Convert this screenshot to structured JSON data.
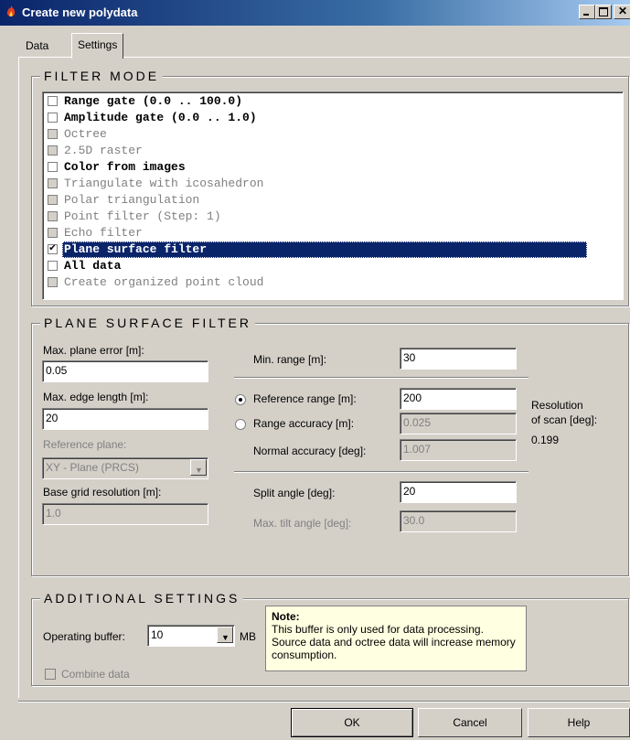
{
  "window": {
    "title": "Create new polydata"
  },
  "tabs": [
    {
      "label": "Data"
    },
    {
      "label": "Settings"
    }
  ],
  "filter_mode": {
    "title": "FILTER MODE",
    "items": [
      {
        "label": "Range gate (0.0 .. 100.0)",
        "checked": false,
        "enabled": true
      },
      {
        "label": "Amplitude gate (0.0 .. 1.0)",
        "checked": false,
        "enabled": true
      },
      {
        "label": "Octree",
        "checked": false,
        "enabled": false
      },
      {
        "label": "2.5D raster",
        "checked": false,
        "enabled": false
      },
      {
        "label": "Color from images",
        "checked": false,
        "enabled": true
      },
      {
        "label": "Triangulate with icosahedron",
        "checked": false,
        "enabled": false
      },
      {
        "label": "Polar triangulation",
        "checked": false,
        "enabled": false
      },
      {
        "label": "Point filter (Step: 1)",
        "checked": false,
        "enabled": false
      },
      {
        "label": "Echo filter",
        "checked": false,
        "enabled": false
      },
      {
        "label": "Plane surface filter",
        "checked": true,
        "enabled": true,
        "selected": true
      },
      {
        "label": "All data",
        "checked": false,
        "enabled": true
      },
      {
        "label": "Create organized point cloud",
        "checked": false,
        "enabled": false
      }
    ]
  },
  "plane_surface": {
    "title": "PLANE SURFACE FILTER",
    "max_plane_error_label": "Max. plane error [m]:",
    "max_plane_error": "0.05",
    "max_edge_length_label": "Max. edge length [m]:",
    "max_edge_length": "20",
    "reference_plane_label": "Reference plane:",
    "reference_plane": "XY - Plane (PRCS)",
    "base_grid_label": "Base grid resolution [m]:",
    "base_grid": "1.0",
    "min_range_label": "Min. range [m]:",
    "min_range": "30",
    "reference_range_label": "Reference range [m]:",
    "reference_range": "200",
    "range_accuracy_label": "Range accuracy [m]:",
    "range_accuracy": "0.025",
    "normal_accuracy_label": "Normal accuracy [deg]:",
    "normal_accuracy": "1.007",
    "split_angle_label": "Split angle [deg]:",
    "split_angle": "20",
    "max_tilt_label": "Max. tilt angle [deg]:",
    "max_tilt": "30.0",
    "resolution_label_1": "Resolution",
    "resolution_label_2": "of scan [deg]:",
    "resolution_value": "0.199"
  },
  "additional": {
    "title": "ADDITIONAL SETTINGS",
    "operating_buffer_label": "Operating buffer:",
    "operating_buffer": "10",
    "unit": "MB",
    "combine_label": "Combine data",
    "note_title": "Note:",
    "note_text": "This buffer is only used for data processing. Source data and octree data will increase memory consumption."
  },
  "buttons": {
    "ok": "OK",
    "cancel": "Cancel",
    "help": "Help"
  },
  "colors": {
    "face": "#d4d0c8",
    "selection": "#0a246a",
    "note_bg": "#ffffe1"
  },
  "icons": {
    "app": "fire-icon",
    "minimize": "minimize-icon",
    "maximize": "maximize-icon",
    "close": "close-icon"
  }
}
